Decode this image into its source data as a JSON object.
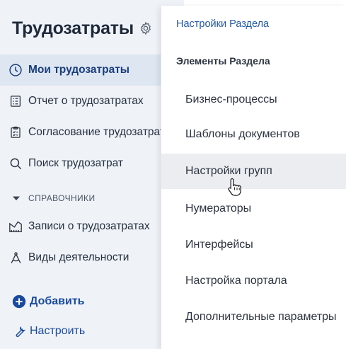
{
  "sidebar": {
    "title": "Трудозатраты",
    "nav": [
      {
        "label": "Мои трудозатраты",
        "icon": "clock-icon",
        "active": true
      },
      {
        "label": "Отчет о трудозатратах",
        "icon": "checklist-icon"
      },
      {
        "label": "Согласование трудозатрат",
        "icon": "clipboard-check-icon"
      },
      {
        "label": "Поиск трудозатрат",
        "icon": "search-icon"
      }
    ],
    "section_label": "СПРАВОЧНИКИ",
    "directory": [
      {
        "label": "Записи о трудозатратах",
        "icon": "ruler-icon"
      },
      {
        "label": "Виды деятельности",
        "icon": "compass-icon"
      }
    ],
    "actions": {
      "add_label": "Добавить",
      "configure_label": "Настроить"
    }
  },
  "dropdown": {
    "header": "Настройки Раздела",
    "group_title": "Элементы Раздела",
    "items": [
      {
        "label": "Бизнес-процессы"
      },
      {
        "label": "Шаблоны документов"
      },
      {
        "label": "Настройки групп",
        "hovered": true
      },
      {
        "label": "Нумераторы"
      },
      {
        "label": "Интерфейсы"
      },
      {
        "label": "Настройка портала"
      },
      {
        "label": "Дополнительные параметры"
      }
    ]
  },
  "colors": {
    "sidebar_bg": "#eff3f8",
    "active_bg": "#dde6f1",
    "accent": "#1f5aa6",
    "hover_bg": "#ebedf0"
  }
}
